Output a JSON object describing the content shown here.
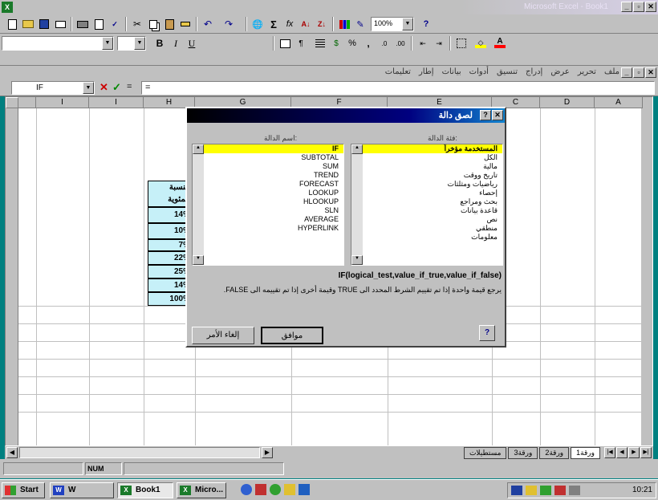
{
  "titlebar": {
    "title": "Microsoft Excel - Book1",
    "app_icon": "X"
  },
  "formatting": {
    "font_name": "",
    "font_size": "",
    "bold": "B",
    "italic": "I",
    "underline": "U"
  },
  "standard": {
    "zoom": "100%"
  },
  "menubar": {
    "items": [
      "ملف",
      "تحرير",
      "عرض",
      "إدراج",
      "تنسيق",
      "أدوات",
      "بيانات",
      "إطار",
      "تعليمات"
    ]
  },
  "formula": {
    "namebox": "IF",
    "cancel": "✕",
    "enter": "✓",
    "equals": "=",
    "content": "="
  },
  "columns": [
    "",
    "I",
    "I",
    "H",
    "G",
    "F",
    "E",
    "C",
    "D",
    "A"
  ],
  "cells": [
    "النسبة",
    "المئوية",
    "14%",
    "10%",
    "7%",
    "22%",
    "25%",
    "14%",
    "100%"
  ],
  "dialog": {
    "title": "لصق دالة",
    "category_label": "فئة الدالة:",
    "function_label": "اسم الدالة:",
    "categories": [
      "المستخدمة مؤخراً",
      "الكل",
      "مالية",
      "تاريخ ووقت",
      "رياضيات ومثلثات",
      "إحصاء",
      "بحث ومراجع",
      "قاعدة بيانات",
      "نص",
      "منطقي",
      "معلومات"
    ],
    "functions": [
      "IF",
      "SUBTOTAL",
      "SUM",
      "TREND",
      "FORECAST",
      "LOOKUP",
      "HLOOKUP",
      "SLN",
      "AVERAGE",
      "HYPERLINK"
    ],
    "signature": "IF(logical_test,value_if_true,value_if_false)",
    "description": "يرجع قيمة واحدة إذا تم تقييم الشرط المحدد الى TRUE وقيمة أخرى إذا تم تقييمه الى FALSE.",
    "ok_label": "موافق",
    "cancel_label": "إلغاء الأمر",
    "help_icon": "?"
  },
  "sheet_tabs": [
    "ورقة1",
    "ورقة2",
    "ورقة3",
    "مستطيلات"
  ],
  "status": {
    "mode": "NUM"
  },
  "taskbar": {
    "start_label": "Start",
    "tasks": [
      {
        "label": "W"
      },
      {
        "label": "Book1",
        "active": true
      },
      {
        "label": "Micro..."
      }
    ],
    "clock": "10:21"
  }
}
